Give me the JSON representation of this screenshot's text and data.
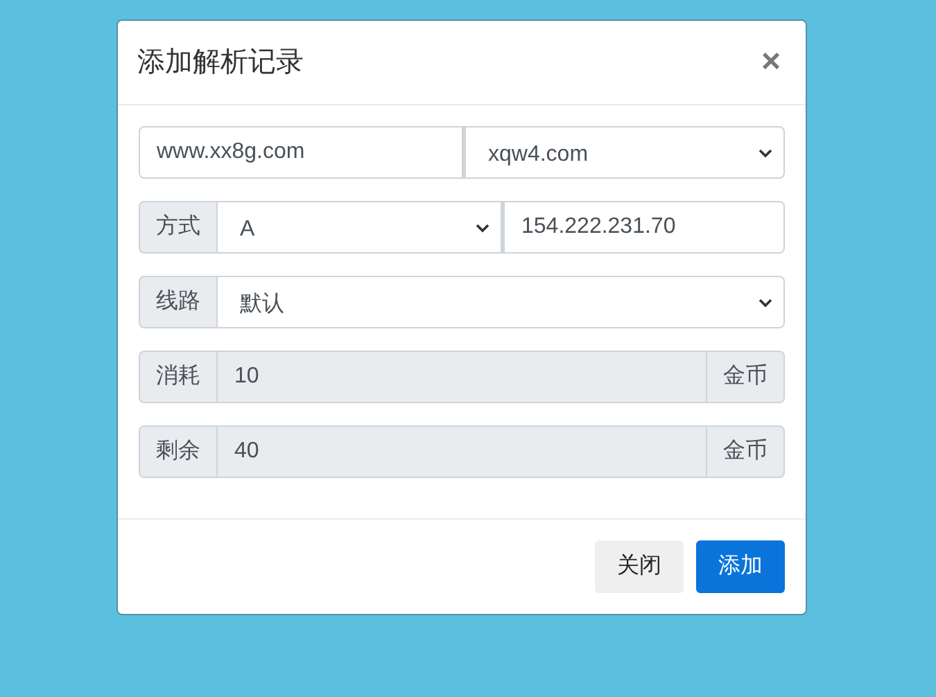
{
  "dialog": {
    "title": "添加解析记录",
    "close": "×"
  },
  "domain_row": {
    "subdomain": "www.xx8g.com",
    "domain": "xqw4.com"
  },
  "type_row": {
    "label": "方式",
    "record_type": "A",
    "value": "154.222.231.70"
  },
  "line_row": {
    "label": "线路",
    "value": "默认"
  },
  "cost_rows": [
    {
      "label": "消耗",
      "value": "10",
      "unit": "金币"
    },
    {
      "label": "剩余",
      "value": "40",
      "unit": "金币"
    }
  ],
  "buttons": [
    {
      "label": "关闭",
      "kind": "secondary"
    },
    {
      "label": "添加",
      "kind": "primary"
    }
  ]
}
